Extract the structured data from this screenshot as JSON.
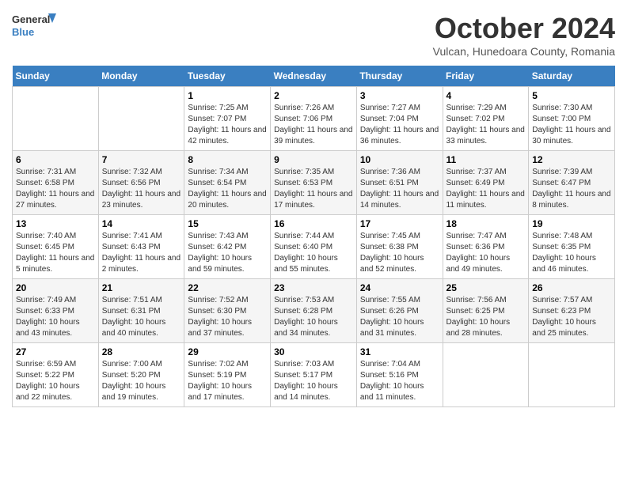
{
  "header": {
    "logo_general": "General",
    "logo_blue": "Blue",
    "month_title": "October 2024",
    "location": "Vulcan, Hunedoara County, Romania"
  },
  "calendar": {
    "days_of_week": [
      "Sunday",
      "Monday",
      "Tuesday",
      "Wednesday",
      "Thursday",
      "Friday",
      "Saturday"
    ],
    "weeks": [
      [
        {
          "day": "",
          "info": ""
        },
        {
          "day": "",
          "info": ""
        },
        {
          "day": "1",
          "info": "Sunrise: 7:25 AM\nSunset: 7:07 PM\nDaylight: 11 hours and 42 minutes."
        },
        {
          "day": "2",
          "info": "Sunrise: 7:26 AM\nSunset: 7:06 PM\nDaylight: 11 hours and 39 minutes."
        },
        {
          "day": "3",
          "info": "Sunrise: 7:27 AM\nSunset: 7:04 PM\nDaylight: 11 hours and 36 minutes."
        },
        {
          "day": "4",
          "info": "Sunrise: 7:29 AM\nSunset: 7:02 PM\nDaylight: 11 hours and 33 minutes."
        },
        {
          "day": "5",
          "info": "Sunrise: 7:30 AM\nSunset: 7:00 PM\nDaylight: 11 hours and 30 minutes."
        }
      ],
      [
        {
          "day": "6",
          "info": "Sunrise: 7:31 AM\nSunset: 6:58 PM\nDaylight: 11 hours and 27 minutes."
        },
        {
          "day": "7",
          "info": "Sunrise: 7:32 AM\nSunset: 6:56 PM\nDaylight: 11 hours and 23 minutes."
        },
        {
          "day": "8",
          "info": "Sunrise: 7:34 AM\nSunset: 6:54 PM\nDaylight: 11 hours and 20 minutes."
        },
        {
          "day": "9",
          "info": "Sunrise: 7:35 AM\nSunset: 6:53 PM\nDaylight: 11 hours and 17 minutes."
        },
        {
          "day": "10",
          "info": "Sunrise: 7:36 AM\nSunset: 6:51 PM\nDaylight: 11 hours and 14 minutes."
        },
        {
          "day": "11",
          "info": "Sunrise: 7:37 AM\nSunset: 6:49 PM\nDaylight: 11 hours and 11 minutes."
        },
        {
          "day": "12",
          "info": "Sunrise: 7:39 AM\nSunset: 6:47 PM\nDaylight: 11 hours and 8 minutes."
        }
      ],
      [
        {
          "day": "13",
          "info": "Sunrise: 7:40 AM\nSunset: 6:45 PM\nDaylight: 11 hours and 5 minutes."
        },
        {
          "day": "14",
          "info": "Sunrise: 7:41 AM\nSunset: 6:43 PM\nDaylight: 11 hours and 2 minutes."
        },
        {
          "day": "15",
          "info": "Sunrise: 7:43 AM\nSunset: 6:42 PM\nDaylight: 10 hours and 59 minutes."
        },
        {
          "day": "16",
          "info": "Sunrise: 7:44 AM\nSunset: 6:40 PM\nDaylight: 10 hours and 55 minutes."
        },
        {
          "day": "17",
          "info": "Sunrise: 7:45 AM\nSunset: 6:38 PM\nDaylight: 10 hours and 52 minutes."
        },
        {
          "day": "18",
          "info": "Sunrise: 7:47 AM\nSunset: 6:36 PM\nDaylight: 10 hours and 49 minutes."
        },
        {
          "day": "19",
          "info": "Sunrise: 7:48 AM\nSunset: 6:35 PM\nDaylight: 10 hours and 46 minutes."
        }
      ],
      [
        {
          "day": "20",
          "info": "Sunrise: 7:49 AM\nSunset: 6:33 PM\nDaylight: 10 hours and 43 minutes."
        },
        {
          "day": "21",
          "info": "Sunrise: 7:51 AM\nSunset: 6:31 PM\nDaylight: 10 hours and 40 minutes."
        },
        {
          "day": "22",
          "info": "Sunrise: 7:52 AM\nSunset: 6:30 PM\nDaylight: 10 hours and 37 minutes."
        },
        {
          "day": "23",
          "info": "Sunrise: 7:53 AM\nSunset: 6:28 PM\nDaylight: 10 hours and 34 minutes."
        },
        {
          "day": "24",
          "info": "Sunrise: 7:55 AM\nSunset: 6:26 PM\nDaylight: 10 hours and 31 minutes."
        },
        {
          "day": "25",
          "info": "Sunrise: 7:56 AM\nSunset: 6:25 PM\nDaylight: 10 hours and 28 minutes."
        },
        {
          "day": "26",
          "info": "Sunrise: 7:57 AM\nSunset: 6:23 PM\nDaylight: 10 hours and 25 minutes."
        }
      ],
      [
        {
          "day": "27",
          "info": "Sunrise: 6:59 AM\nSunset: 5:22 PM\nDaylight: 10 hours and 22 minutes."
        },
        {
          "day": "28",
          "info": "Sunrise: 7:00 AM\nSunset: 5:20 PM\nDaylight: 10 hours and 19 minutes."
        },
        {
          "day": "29",
          "info": "Sunrise: 7:02 AM\nSunset: 5:19 PM\nDaylight: 10 hours and 17 minutes."
        },
        {
          "day": "30",
          "info": "Sunrise: 7:03 AM\nSunset: 5:17 PM\nDaylight: 10 hours and 14 minutes."
        },
        {
          "day": "31",
          "info": "Sunrise: 7:04 AM\nSunset: 5:16 PM\nDaylight: 10 hours and 11 minutes."
        },
        {
          "day": "",
          "info": ""
        },
        {
          "day": "",
          "info": ""
        }
      ]
    ]
  }
}
